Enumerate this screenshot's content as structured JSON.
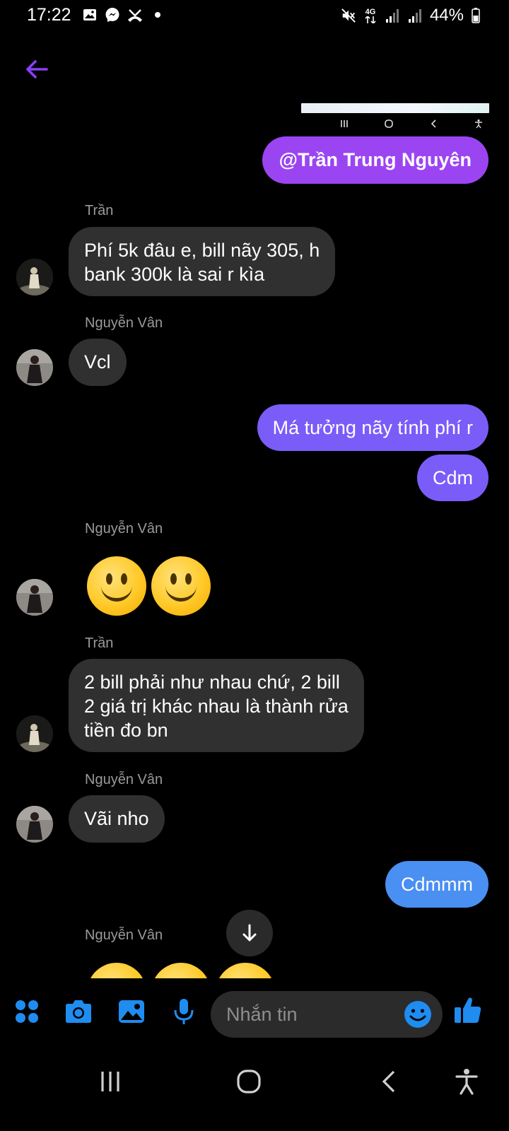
{
  "status": {
    "time": "17:22",
    "battery": "44%",
    "network": "4G",
    "icons_left": [
      "gallery-icon",
      "messenger-icon",
      "missed-call-icon",
      "dot-icon"
    ],
    "icons_right": [
      "mute-icon",
      "network-4g-icon",
      "signal-icon",
      "signal-icon",
      "battery-icon"
    ]
  },
  "header": {
    "back_icon": "arrow-left-icon",
    "accent": "#8b3dff"
  },
  "shared_screenshot_nav": [
    "recent-apps-icon",
    "home-icon",
    "back-icon",
    "accessibility-icon"
  ],
  "messages": [
    {
      "dir": "out",
      "text": "@Trần Trung Nguyên",
      "color": "#9b45f2",
      "bold": true
    },
    {
      "dir": "in",
      "sender": "Trần",
      "text_lines": [
        "Phí 5k đâu e, bill nãy 305, h",
        "bank 300k là sai r kìa"
      ]
    },
    {
      "dir": "in",
      "sender": "Nguyễn Vân",
      "text": "Vcl"
    },
    {
      "dir": "out",
      "text": "Má tưởng nãy tính phí r",
      "color": "#7a5cf8"
    },
    {
      "dir": "out",
      "text": "Cdm",
      "color": "#7a5cf8"
    },
    {
      "dir": "in",
      "sender": "Nguyễn Vân",
      "emoji": [
        "slightly-smiling-face",
        "slightly-smiling-face"
      ]
    },
    {
      "dir": "in",
      "sender": "Trần",
      "text_lines": [
        "2 bill phải như nhau chứ, 2 bill",
        "2 giá trị khác nhau là thành rửa",
        "tiền đo bn"
      ]
    },
    {
      "dir": "in",
      "sender": "Nguyễn Vân",
      "text": "Vãi nho"
    },
    {
      "dir": "out",
      "text": "Cdmmm",
      "color": "#4a8ff2"
    },
    {
      "dir": "in",
      "sender": "Nguyễn Vân",
      "emoji": [
        "slightly-smiling-face",
        "slightly-smiling-face",
        "slightly-smiling-face"
      ],
      "partial": true
    }
  ],
  "scroll_down_icon": "arrow-down-icon",
  "composer": {
    "placeholder": "Nhắn tin",
    "icons": [
      "apps-grid-icon",
      "camera-icon",
      "gallery-icon",
      "microphone-icon"
    ],
    "emoji_icon": "emoji-icon",
    "like_icon": "thumbs-up-icon",
    "accent": "#1f8cf0"
  },
  "navbar": [
    "recent-apps-icon",
    "home-icon",
    "back-icon",
    "accessibility-icon"
  ]
}
